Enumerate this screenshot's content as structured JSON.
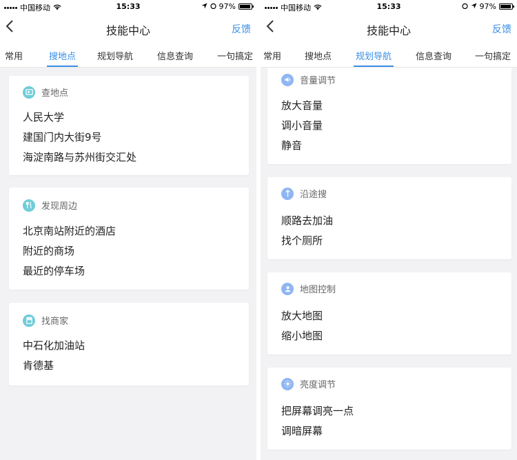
{
  "screens": [
    {
      "status": {
        "carrier": "中国移动",
        "time": "15:33",
        "battery": "97%"
      },
      "nav": {
        "back_icon": "chevron-left-icon",
        "title": "技能中心",
        "feedback": "反馈"
      },
      "tabs": [
        "常用",
        "搜地点",
        "规划导航",
        "信息查询",
        "一句搞定"
      ],
      "active_tab": 1,
      "cards": [
        {
          "icon": "search-location-icon",
          "title": "查地点",
          "items": [
            "人民大学",
            "建国门内大街9号",
            "海淀南路与苏州街交汇处"
          ]
        },
        {
          "icon": "fork-knife-icon",
          "title": "发现周边",
          "items": [
            "北京南站附近的酒店",
            "附近的商场",
            "最近的停车场"
          ]
        },
        {
          "icon": "store-icon",
          "title": "找商家",
          "items": [
            "中石化加油站",
            "肯德基"
          ]
        }
      ]
    },
    {
      "status": {
        "carrier": "中国移动",
        "time": "15:33",
        "battery": "97%"
      },
      "nav": {
        "back_icon": "chevron-left-icon",
        "title": "技能中心",
        "feedback": "反馈"
      },
      "tabs": [
        "常用",
        "搜地点",
        "规划导航",
        "信息查询",
        "一句搞定"
      ],
      "active_tab": 2,
      "cards": [
        {
          "icon": "volume-icon",
          "title": "音量调节",
          "items": [
            "放大音量",
            "调小音量",
            "静音"
          ]
        },
        {
          "icon": "route-icon",
          "title": "沿途搜",
          "items": [
            "顺路去加油",
            "找个厕所"
          ]
        },
        {
          "icon": "map-control-icon",
          "title": "地图控制",
          "items": [
            "放大地图",
            "缩小地图"
          ]
        },
        {
          "icon": "brightness-icon",
          "title": "亮度调节",
          "items": [
            "把屏幕调亮一点",
            "调暗屏幕"
          ]
        }
      ]
    }
  ],
  "colors": {
    "accent": "#3a8ee6",
    "icon_teal": "#6fcdd9",
    "icon_blue": "#8fb6f2",
    "background": "#f2f2f4"
  }
}
